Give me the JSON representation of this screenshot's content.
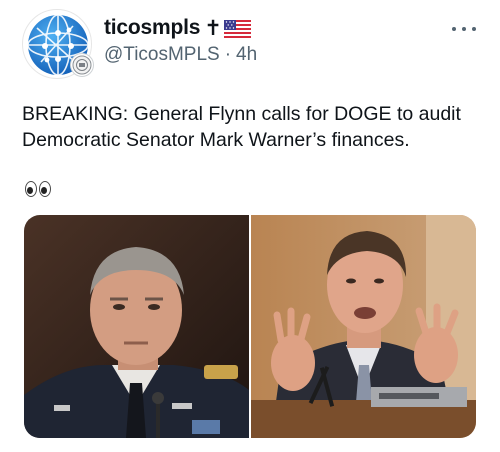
{
  "account": {
    "display_name": "ticosmpls",
    "name_suffix": "✝",
    "handle": "@TicosMPLS",
    "separator": "·",
    "timestamp": "4h"
  },
  "tweet": {
    "text": "BREAKING: General Flynn calls for DOGE to audit Democratic Senator Mark Warner’s finances.",
    "emoji_line": "eyes"
  },
  "icons": {
    "avatar": "globe-network-logo",
    "badge": "government-seal-badge",
    "flag": "us-flag-icon",
    "more": "more-options-icon"
  },
  "media": {
    "count": 2,
    "photos": [
      {
        "subject": "man in dark army uniform"
      },
      {
        "subject": "man in suit gesturing at hearing"
      }
    ]
  },
  "colors": {
    "text": "#0f1419",
    "secondary_text": "#536471",
    "background": "#ffffff",
    "avatar_blue": "#1e78d6"
  }
}
